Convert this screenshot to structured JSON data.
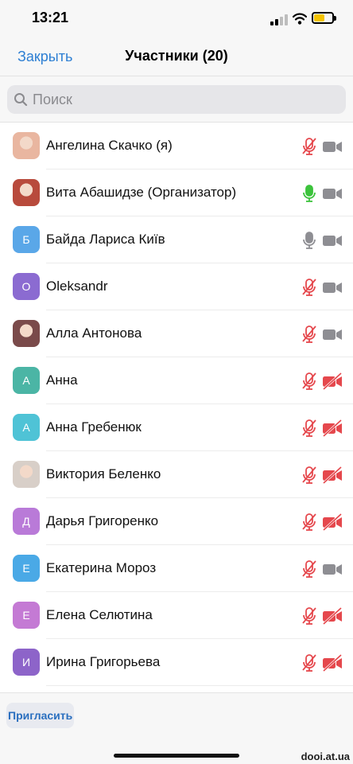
{
  "status_bar": {
    "time": "13:21"
  },
  "header": {
    "close_label": "Закрыть",
    "title": "Участники (20)"
  },
  "search": {
    "placeholder": "Поиск",
    "value": ""
  },
  "participants": [
    {
      "name": "Ангелина Скачко (я)",
      "avatar_type": "photo",
      "avatar_letter": "",
      "avatar_color": "#e9b6a0",
      "mic": "muted",
      "camera": "on"
    },
    {
      "name": "Вита Абашидзе (Организатор)",
      "avatar_type": "photo",
      "avatar_letter": "",
      "avatar_color": "#b84a3c",
      "mic": "active",
      "camera": "on"
    },
    {
      "name": "Байда Лариса Київ",
      "avatar_type": "letter",
      "avatar_letter": "Б",
      "avatar_color": "#5aa7e8",
      "mic": "on",
      "camera": "on"
    },
    {
      "name": "Oleksandr",
      "avatar_type": "letter",
      "avatar_letter": "O",
      "avatar_color": "#8b6bd1",
      "mic": "muted",
      "camera": "on"
    },
    {
      "name": "Алла Антонова",
      "avatar_type": "photo",
      "avatar_letter": "",
      "avatar_color": "#7a4a4a",
      "mic": "muted",
      "camera": "on"
    },
    {
      "name": "Анна",
      "avatar_type": "letter",
      "avatar_letter": "А",
      "avatar_color": "#4bb5a5",
      "mic": "muted",
      "camera": "off"
    },
    {
      "name": "Анна Гребенюк",
      "avatar_type": "letter",
      "avatar_letter": "А",
      "avatar_color": "#4fc3d6",
      "mic": "muted",
      "camera": "off"
    },
    {
      "name": "Виктория Беленко",
      "avatar_type": "photo",
      "avatar_letter": "",
      "avatar_color": "#d8cfc8",
      "mic": "muted",
      "camera": "off"
    },
    {
      "name": "Дарья Григоренко",
      "avatar_type": "letter",
      "avatar_letter": "Д",
      "avatar_color": "#b97ad8",
      "mic": "muted",
      "camera": "off"
    },
    {
      "name": "Екатерина Мороз",
      "avatar_type": "letter",
      "avatar_letter": "Е",
      "avatar_color": "#4aa9e6",
      "mic": "muted",
      "camera": "on"
    },
    {
      "name": "Елена Селютина",
      "avatar_type": "letter",
      "avatar_letter": "Е",
      "avatar_color": "#c47ad4",
      "mic": "muted",
      "camera": "off"
    },
    {
      "name": "Ирина Григорьева",
      "avatar_type": "letter",
      "avatar_letter": "И",
      "avatar_color": "#8d64c9",
      "mic": "muted",
      "camera": "off"
    }
  ],
  "footer": {
    "invite_label": "Пригласить",
    "watermark": "dooi.at.ua"
  },
  "colors": {
    "accent": "#2d7fd3",
    "muted_red": "#e5484d",
    "active_green": "#3cc33c",
    "icon_gray": "#8e8e93"
  },
  "icons": {
    "search": "magnifier-icon",
    "mic": "microphone-icon",
    "mic_muted": "microphone-muted-icon",
    "camera": "video-camera-icon",
    "camera_off": "video-camera-off-icon"
  }
}
